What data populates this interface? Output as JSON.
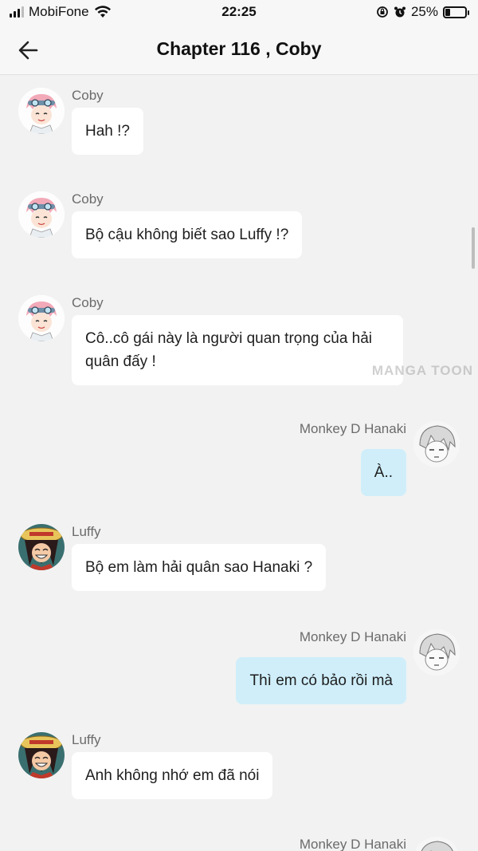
{
  "status_bar": {
    "carrier": "MobiFone",
    "time": "22:25",
    "battery_percent": "25%",
    "battery_level": 0.25,
    "icons": [
      "signal-icon",
      "wifi-icon",
      "rotation-lock-icon",
      "alarm-icon",
      "battery-icon"
    ]
  },
  "header": {
    "back_icon": "arrow-left-icon",
    "title": "Chapter 116 , Coby"
  },
  "watermark": "MANGA TOON",
  "messages": [
    {
      "side": "left",
      "sender": "Coby",
      "text": "Hah !?"
    },
    {
      "side": "left",
      "sender": "Coby",
      "text": "Bộ cậu không biết sao Luffy !?"
    },
    {
      "side": "left",
      "sender": "Coby",
      "text_line1": "Cô..cô gái này là người quan trọng của hải",
      "text_line2": "quân đấy !"
    },
    {
      "side": "right",
      "sender": "Monkey D Hanaki",
      "text": "À.."
    },
    {
      "side": "left",
      "sender": "Luffy",
      "text": "Bộ em làm hải quân sao Hanaki ?"
    },
    {
      "side": "right",
      "sender": "Monkey D Hanaki",
      "text": "Thì em có bảo rồi mà"
    },
    {
      "side": "left",
      "sender": "Luffy",
      "text": "Anh không nhớ em đã nói"
    },
    {
      "side": "right",
      "sender": "Monkey D Hanaki",
      "text": ""
    }
  ],
  "colors": {
    "background": "#f2f2f2",
    "incoming_bubble": "#ffffff",
    "outgoing_bubble": "#cfeefa"
  }
}
